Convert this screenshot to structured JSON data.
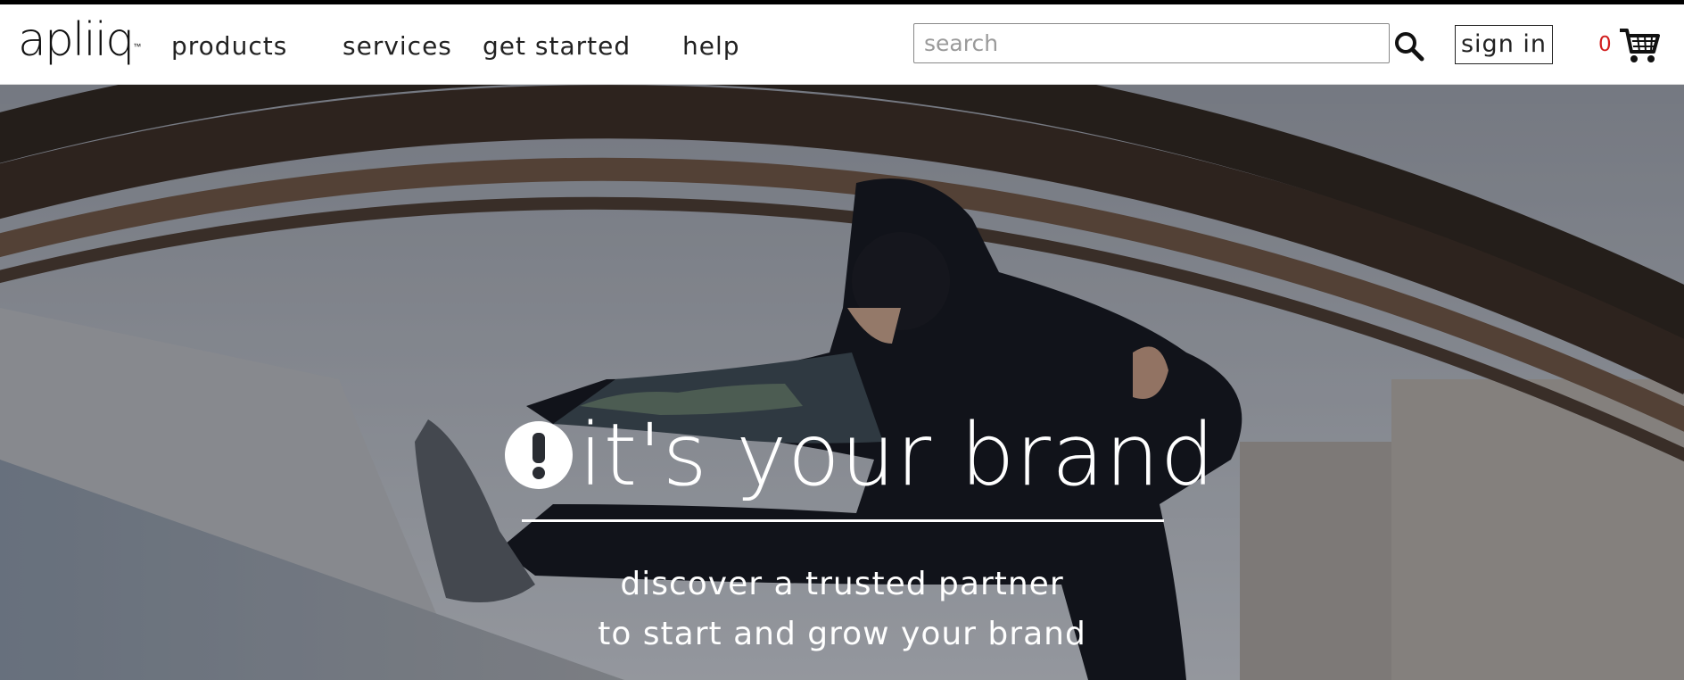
{
  "header": {
    "logo_text": "apliiq",
    "logo_tm": "™",
    "nav": [
      {
        "label": "products"
      },
      {
        "label": "services"
      },
      {
        "label": "get started"
      },
      {
        "label": "help"
      }
    ],
    "search": {
      "placeholder": "search",
      "value": ""
    },
    "sign_in_label": "sign in",
    "cart": {
      "count": "0",
      "count_color": "#d21f1f"
    }
  },
  "hero": {
    "title": "it's your brand",
    "subtitle_line1": "discover a trusted partner",
    "subtitle_line2": "to start and grow your brand"
  }
}
